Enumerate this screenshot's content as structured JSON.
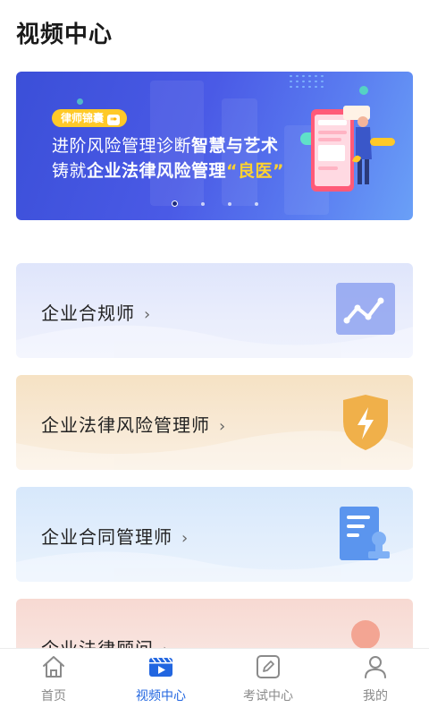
{
  "header": {
    "title": "视频中心"
  },
  "banner": {
    "tag": "律师锦囊",
    "line1_normal": "进阶风险管理诊断",
    "line1_bold": "智慧与艺术",
    "line2_normal": "铸就",
    "line2_bold": "企业法律风险管理",
    "line2_highlight": "“良医”",
    "pager": {
      "count": 4,
      "active_index": 0
    }
  },
  "courses": [
    {
      "label": "企业合规师",
      "icon": "line-chart-icon",
      "color": "#8fa3f0"
    },
    {
      "label": "企业法律风险管理师",
      "icon": "shield-lightning-icon",
      "color": "#f0b04a"
    },
    {
      "label": "企业合同管理师",
      "icon": "contract-seal-icon",
      "color": "#5b95ee"
    },
    {
      "label": "企业法律顾问",
      "icon": "circle-icon",
      "color": "#f29a86"
    }
  ],
  "tabbar": {
    "items": [
      {
        "label": "首页",
        "icon": "home-icon",
        "active": false
      },
      {
        "label": "视频中心",
        "icon": "video-icon",
        "active": true
      },
      {
        "label": "考试中心",
        "icon": "exam-edit-icon",
        "active": false
      },
      {
        "label": "我的",
        "icon": "user-icon",
        "active": false
      }
    ],
    "active_color": "#2266e0",
    "inactive_color": "#8a8a8a"
  }
}
